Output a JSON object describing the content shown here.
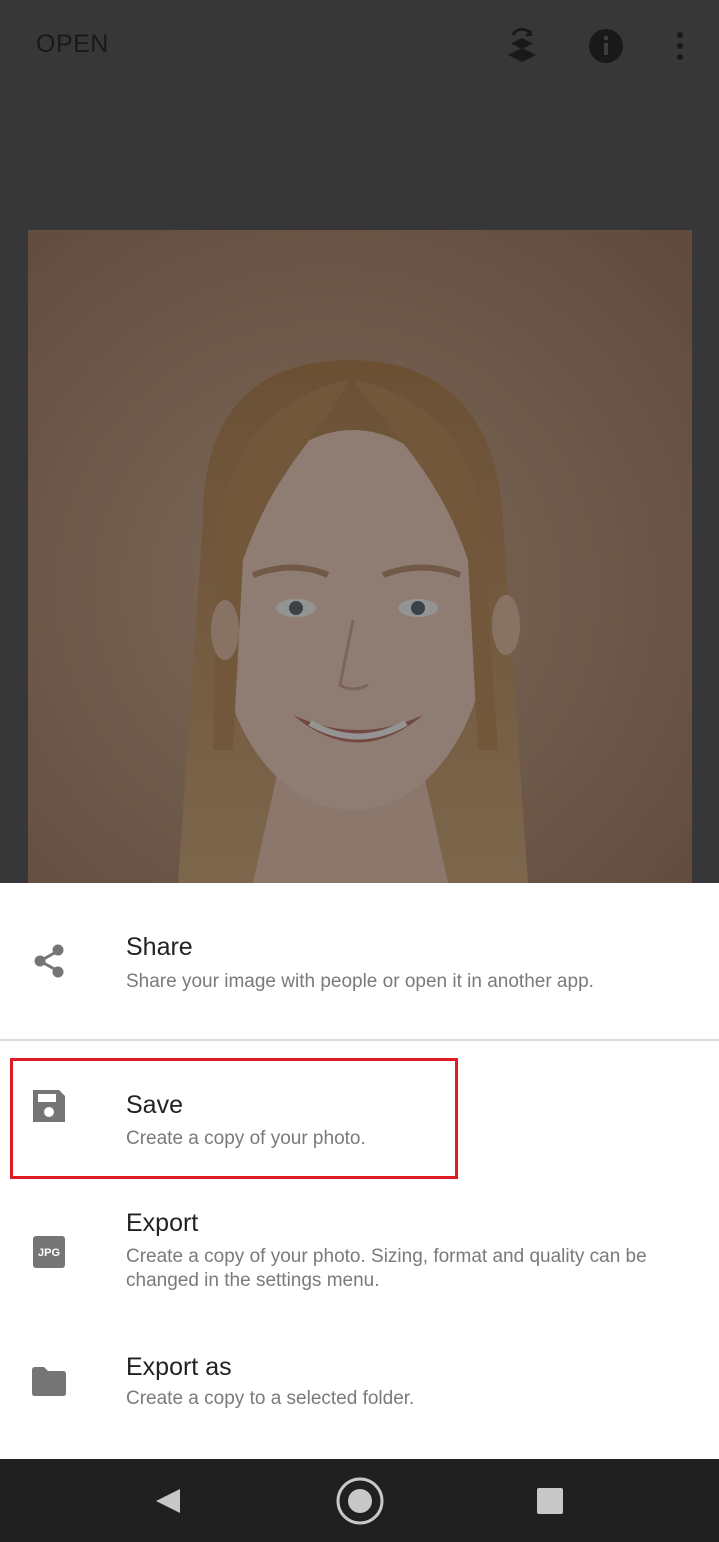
{
  "topbar": {
    "open_label": "OPEN",
    "icons": [
      "layers-rotate-icon",
      "info-icon",
      "more-vert-icon"
    ]
  },
  "photo": {
    "subject": "portrait"
  },
  "sheet": {
    "items": [
      {
        "title": "Share",
        "subtitle": "Share your image with people or open it in another app.",
        "icon": "share-icon"
      },
      {
        "title": "Save",
        "subtitle": "Create a copy of your photo.",
        "icon": "save-icon"
      },
      {
        "title": "Export",
        "subtitle": "Create a copy of your photo. Sizing, format and quality can be changed in the settings menu.",
        "icon": "jpg-icon",
        "icon_text": "JPG"
      },
      {
        "title": "Export as",
        "subtitle": "Create a copy to a selected folder.",
        "icon": "folder-icon"
      }
    ],
    "highlight_color": "#e01b24"
  },
  "navbar": {
    "buttons": [
      "back-icon",
      "home-icon",
      "recents-icon"
    ]
  },
  "colors": {
    "icon_gray": "#757575",
    "title_text": "#222222",
    "subtitle_text": "#7a7a7a",
    "nav_background": "#202020"
  }
}
